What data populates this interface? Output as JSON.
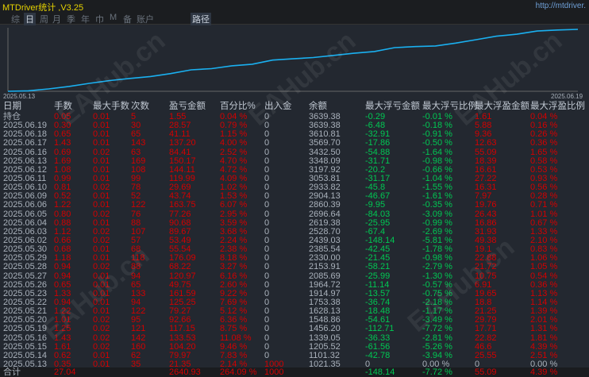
{
  "title": "MTDriver统计 ,V3.25",
  "url": "http://mtdriver.",
  "tabs": [
    "综",
    "日",
    "周",
    "月",
    "季",
    "年",
    "巾",
    "M",
    "备",
    "账户"
  ],
  "active_tab": 1,
  "path_button": "路径",
  "chart": {
    "start_label": "2025.05.13",
    "end_label": "2025.06.19",
    "line_color": "#1ab0f0"
  },
  "columns": [
    "日期",
    "手数",
    "最大手数",
    "次数",
    "盈亏金额",
    "百分比%",
    "出入金",
    "余额",
    "最大浮亏金额",
    "最大浮亏比例",
    "最大浮盈金额",
    "最大浮盈比例"
  ],
  "rows": [
    [
      "持仓",
      "0.05",
      "0.01",
      "5",
      "1.55",
      "0.04 %",
      "0",
      "3639.38",
      "-0.29",
      "-0.01 %",
      "1.61",
      "0.04 %"
    ],
    [
      "2025.06.19",
      "0.30",
      "0.01",
      "30",
      "28.57",
      "0.79 %",
      "0",
      "3639.38",
      "-6.48",
      "-0.18 %",
      "5.88",
      "0.16 %"
    ],
    [
      "2025.06.18",
      "0.65",
      "0.01",
      "65",
      "41.11",
      "1.15 %",
      "0",
      "3610.81",
      "-32.91",
      "-0.91 %",
      "9.36",
      "0.26 %"
    ],
    [
      "2025.06.17",
      "1.43",
      "0.01",
      "143",
      "137.20",
      "4.00 %",
      "0",
      "3569.70",
      "-17.86",
      "-0.50 %",
      "12.63",
      "0.36 %"
    ],
    [
      "2025.06.16",
      "0.69",
      "0.02",
      "63",
      "84.41",
      "2.52 %",
      "0",
      "3432.50",
      "-54.88",
      "-1.64 %",
      "55.09",
      "1.65 %"
    ],
    [
      "2025.06.13",
      "1.69",
      "0.01",
      "169",
      "150.17",
      "4.70 %",
      "0",
      "3348.09",
      "-31.71",
      "-0.98 %",
      "18.39",
      "0.58 %"
    ],
    [
      "2025.06.12",
      "1.08",
      "0.01",
      "108",
      "144.11",
      "4.72 %",
      "0",
      "3197.92",
      "-20.2",
      "-0.66 %",
      "16.61",
      "0.53 %"
    ],
    [
      "2025.06.11",
      "0.99",
      "0.01",
      "99",
      "119.99",
      "4.09 %",
      "0",
      "3053.81",
      "-31.17",
      "-1.04 %",
      "27.22",
      "0.93 %"
    ],
    [
      "2025.06.10",
      "0.81",
      "0.02",
      "78",
      "29.69",
      "1.02 %",
      "0",
      "2933.82",
      "-45.8",
      "-1.55 %",
      "16.31",
      "0.56 %"
    ],
    [
      "2025.06.09",
      "0.52",
      "0.01",
      "52",
      "43.74",
      "1.53 %",
      "0",
      "2904.13",
      "-46.67",
      "-1.61 %",
      "7.97",
      "0.28 %"
    ],
    [
      "2025.06.06",
      "1.22",
      "0.01",
      "122",
      "163.75",
      "6.07 %",
      "0",
      "2860.39",
      "-9.95",
      "-0.35 %",
      "19.76",
      "0.71 %"
    ],
    [
      "2025.06.05",
      "0.80",
      "0.02",
      "76",
      "77.26",
      "2.95 %",
      "0",
      "2696.64",
      "-84.03",
      "-3.09 %",
      "26.43",
      "1.01 %"
    ],
    [
      "2025.06.04",
      "0.88",
      "0.01",
      "88",
      "90.68",
      "3.59 %",
      "0",
      "2619.38",
      "-25.95",
      "-0.99 %",
      "16.86",
      "0.67 %"
    ],
    [
      "2025.06.03",
      "1.12",
      "0.02",
      "107",
      "89.67",
      "3.68 %",
      "0",
      "2528.70",
      "-67.4",
      "-2.69 %",
      "31.93",
      "1.33 %"
    ],
    [
      "2025.06.02",
      "0.66",
      "0.02",
      "57",
      "53.49",
      "2.24 %",
      "0",
      "2439.03",
      "-148.14",
      "-5.81 %",
      "49.38",
      "2.10 %"
    ],
    [
      "2025.05.30",
      "0.68",
      "0.01",
      "68",
      "55.54",
      "2.38 %",
      "0",
      "2385.54",
      "-42.45",
      "-1.78 %",
      "19.1",
      "0.83 %"
    ],
    [
      "2025.05.29",
      "1.18",
      "0.01",
      "118",
      "176.09",
      "8.18 %",
      "0",
      "2330.00",
      "-21.45",
      "-0.98 %",
      "22.88",
      "1.06 %"
    ],
    [
      "2025.05.28",
      "0.94",
      "0.02",
      "88",
      "68.22",
      "3.27 %",
      "0",
      "2153.91",
      "-58.21",
      "-2.79 %",
      "21.72",
      "1.05 %"
    ],
    [
      "2025.05.27",
      "0.94",
      "0.01",
      "94",
      "120.97",
      "6.16 %",
      "0",
      "2085.69",
      "-25.99",
      "-1.30 %",
      "10.75",
      "0.54 %"
    ],
    [
      "2025.05.26",
      "0.65",
      "0.01",
      "65",
      "49.75",
      "2.60 %",
      "0",
      "1964.72",
      "-11.14",
      "-0.57 %",
      "6.91",
      "0.36 %"
    ],
    [
      "2025.05.23",
      "1.33",
      "0.01",
      "133",
      "161.59",
      "9.22 %",
      "0",
      "1914.97",
      "-13.57",
      "-0.75 %",
      "19.65",
      "1.13 %"
    ],
    [
      "2025.05.22",
      "0.94",
      "0.01",
      "94",
      "125.25",
      "7.69 %",
      "0",
      "1753.38",
      "-36.74",
      "-2.18 %",
      "18.8",
      "1.14 %"
    ],
    [
      "2025.05.21",
      "1.22",
      "0.01",
      "122",
      "79.27",
      "5.12 %",
      "0",
      "1628.13",
      "-18.48",
      "-1.17 %",
      "21.25",
      "1.39 %"
    ],
    [
      "2025.05.20",
      "1.01",
      "0.02",
      "95",
      "92.66",
      "6.36 %",
      "0",
      "1548.86",
      "-54.61",
      "-3.49 %",
      "29.79",
      "2.01 %"
    ],
    [
      "2025.05.19",
      "1.25",
      "0.02",
      "121",
      "117.15",
      "8.75 %",
      "0",
      "1456.20",
      "-112.71",
      "-7.72 %",
      "17.71",
      "1.31 %"
    ],
    [
      "2025.05.16",
      "1.43",
      "0.02",
      "142",
      "133.53",
      "11.08 %",
      "0",
      "1339.05",
      "-36.33",
      "-2.81 %",
      "22.82",
      "1.81 %"
    ],
    [
      "2025.05.15",
      "1.61",
      "0.02",
      "160",
      "104.20",
      "9.46 %",
      "0",
      "1205.52",
      "-61.56",
      "-5.26 %",
      "46.6",
      "4.39 %"
    ],
    [
      "2025.05.14",
      "0.62",
      "0.01",
      "62",
      "79.97",
      "7.83 %",
      "0",
      "1101.32",
      "-42.78",
      "-3.94 %",
      "25.55",
      "2.51 %"
    ],
    [
      "2025.05.13",
      "0.35",
      "0.01",
      "35",
      "21.35",
      "2.14 %",
      "1000",
      "1021.35",
      "0",
      "0.00 %",
      "0",
      "0.00 %"
    ]
  ],
  "total": [
    "合计",
    "27.04",
    "",
    "",
    "2640.93",
    "264.09 %",
    "1000",
    "",
    "-148.14",
    "-7.72 %",
    "55.09",
    "4.39 %"
  ],
  "colors": {
    "positive": "#d40000",
    "negative": "#00c853",
    "neutral": "#aab2bc"
  },
  "watermark": "EAHub.cn"
}
